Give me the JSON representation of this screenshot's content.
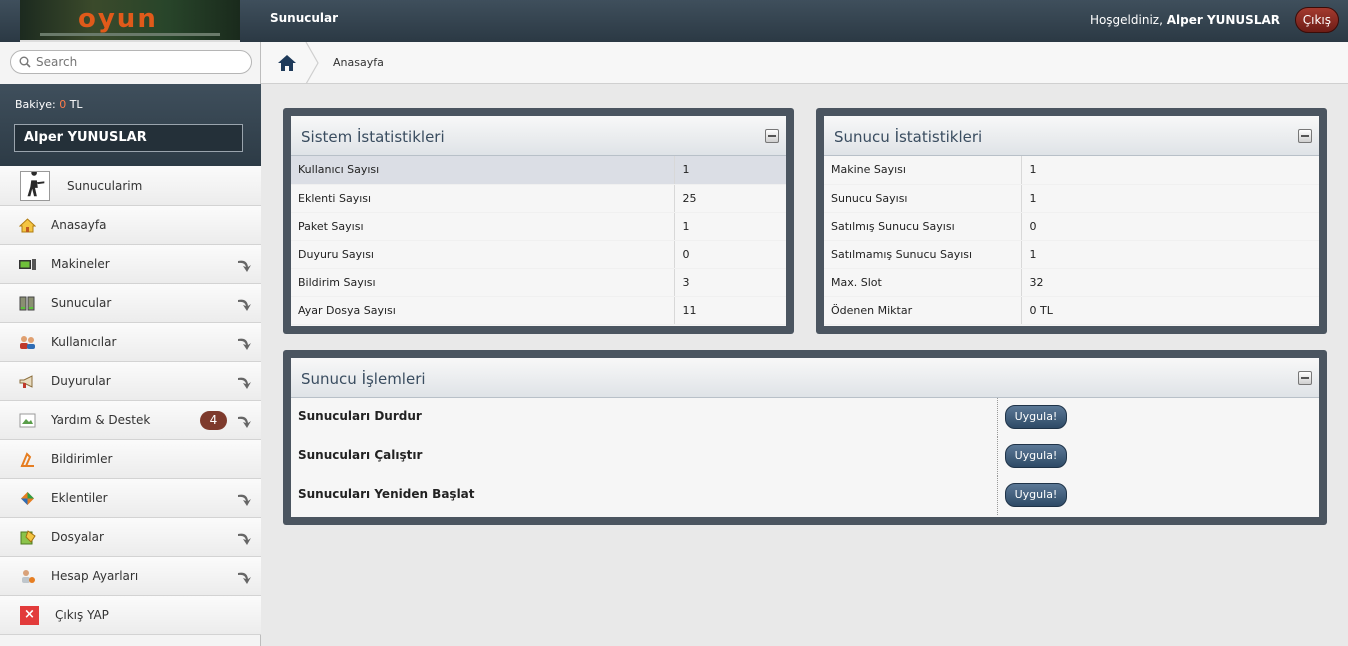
{
  "topbar": {
    "logo_text": "oyun",
    "title": "Sunucular",
    "welcome_prefix": "Hoşgeldiniz,",
    "user_name": "Alper YUNUSLAR",
    "logout_label": "Çıkış"
  },
  "sidebar": {
    "search_placeholder": "Search",
    "balance_label": "Bakiye:",
    "balance_amount": "0",
    "balance_currency": "TL",
    "user_name": "Alper YUNUSLAR",
    "items": [
      {
        "label": "Sunucularim",
        "icon": "player-avatar-icon"
      },
      {
        "label": "Anasayfa",
        "icon": "home-icon"
      },
      {
        "label": "Makineler",
        "icon": "machine-icon"
      },
      {
        "label": "Sunucular",
        "icon": "server-icon"
      },
      {
        "label": "Kullanıcılar",
        "icon": "users-icon"
      },
      {
        "label": "Duyurular",
        "icon": "megaphone-icon"
      },
      {
        "label": "Yardım & Destek",
        "icon": "broken-image-icon",
        "badge": "4"
      },
      {
        "label": "Bildirimler",
        "icon": "notification-icon"
      },
      {
        "label": "Eklentiler",
        "icon": "plugin-icon"
      },
      {
        "label": "Dosyalar",
        "icon": "files-icon"
      },
      {
        "label": "Hesap Ayarları",
        "icon": "account-settings-icon"
      },
      {
        "label": "Çıkış YAP",
        "icon": "close-icon"
      }
    ]
  },
  "breadcrumb": {
    "home": "Anasayfa"
  },
  "system_stats": {
    "title": "Sistem İstatistikleri",
    "rows": [
      {
        "label": "Kullanıcı Sayısı",
        "value": "1"
      },
      {
        "label": "Eklenti Sayısı",
        "value": "25"
      },
      {
        "label": "Paket Sayısı",
        "value": "1"
      },
      {
        "label": "Duyuru Sayısı",
        "value": "0"
      },
      {
        "label": "Bildirim Sayısı",
        "value": "3"
      },
      {
        "label": "Ayar Dosya Sayısı",
        "value": "11"
      }
    ]
  },
  "server_stats": {
    "title": "Sunucu İstatistikleri",
    "rows": [
      {
        "label": "Makine Sayısı",
        "value": "1"
      },
      {
        "label": "Sunucu Sayısı",
        "value": "1"
      },
      {
        "label": "Satılmış Sunucu Sayısı",
        "value": "0"
      },
      {
        "label": "Satılmamış Sunucu Sayısı",
        "value": "1"
      },
      {
        "label": "Max. Slot",
        "value": "32"
      },
      {
        "label": "Ödenen Miktar",
        "value": "0 TL"
      }
    ]
  },
  "server_ops": {
    "title": "Sunucu İşlemleri",
    "apply_label": "Uygula!",
    "rows": [
      {
        "label": "Sunucuları Durdur"
      },
      {
        "label": "Sunucuları Çalıştır"
      },
      {
        "label": "Sunucuları Yeniden Başlat"
      }
    ]
  },
  "colors": {
    "accent": "#3f4f5c",
    "danger": "#a33a2f",
    "badge": "#7e3a2c",
    "button": "#3b5876"
  }
}
